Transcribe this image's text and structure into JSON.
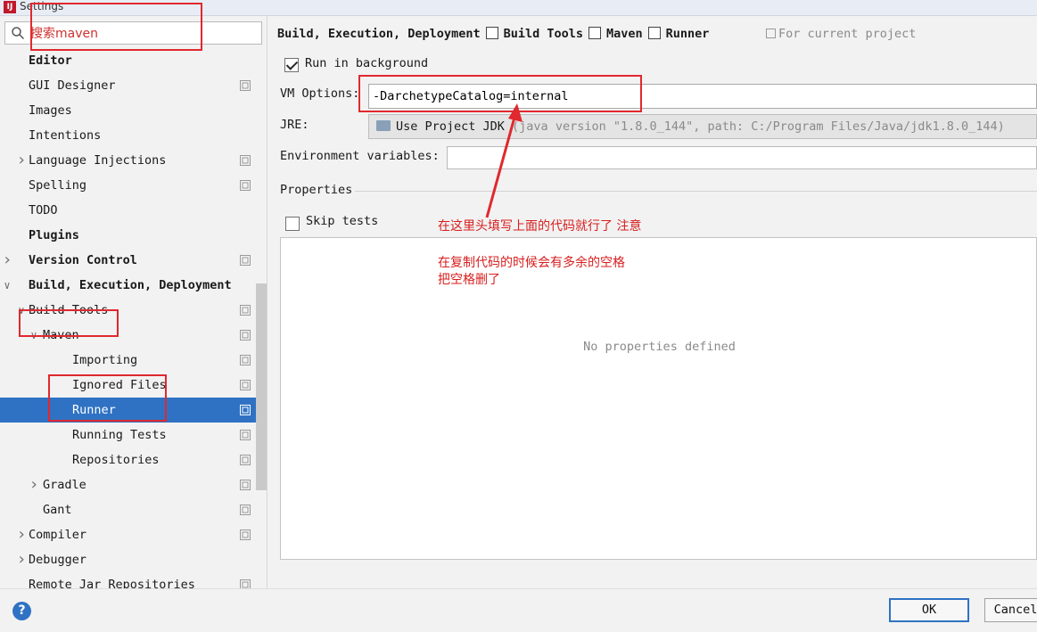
{
  "window": {
    "title": "Settings"
  },
  "search": {
    "value": "搜索maven"
  },
  "sidebar": {
    "items": [
      {
        "label": "Editor",
        "bold": true,
        "level": 0,
        "arrow": "",
        "selected": false,
        "project_icon": false
      },
      {
        "label": "GUI Designer",
        "bold": false,
        "level": 1,
        "arrow": "",
        "selected": false,
        "project_icon": true
      },
      {
        "label": "Images",
        "bold": false,
        "level": 1,
        "arrow": "",
        "selected": false,
        "project_icon": false
      },
      {
        "label": "Intentions",
        "bold": false,
        "level": 1,
        "arrow": "",
        "selected": false,
        "project_icon": false
      },
      {
        "label": "Language Injections",
        "bold": false,
        "level": 1,
        "arrow": "right",
        "selected": false,
        "project_icon": true
      },
      {
        "label": "Spelling",
        "bold": false,
        "level": 1,
        "arrow": "",
        "selected": false,
        "project_icon": true
      },
      {
        "label": "TODO",
        "bold": false,
        "level": 1,
        "arrow": "",
        "selected": false,
        "project_icon": false
      },
      {
        "label": "Plugins",
        "bold": true,
        "level": 0,
        "arrow": "",
        "selected": false,
        "project_icon": false
      },
      {
        "label": "Version Control",
        "bold": true,
        "level": 0,
        "arrow": "right",
        "selected": false,
        "project_icon": true
      },
      {
        "label": "Build, Execution, Deployment",
        "bold": true,
        "level": 0,
        "arrow": "down",
        "selected": false,
        "project_icon": false
      },
      {
        "label": "Build Tools",
        "bold": false,
        "level": 1,
        "arrow": "down",
        "selected": false,
        "project_icon": true
      },
      {
        "label": "Maven",
        "bold": false,
        "level": 2,
        "arrow": "down",
        "selected": false,
        "project_icon": true
      },
      {
        "label": "Importing",
        "bold": false,
        "level": 3,
        "arrow": "",
        "selected": false,
        "project_icon": true
      },
      {
        "label": "Ignored Files",
        "bold": false,
        "level": 3,
        "arrow": "",
        "selected": false,
        "project_icon": true
      },
      {
        "label": "Runner",
        "bold": false,
        "level": 3,
        "arrow": "",
        "selected": true,
        "project_icon": true
      },
      {
        "label": "Running Tests",
        "bold": false,
        "level": 3,
        "arrow": "",
        "selected": false,
        "project_icon": true
      },
      {
        "label": "Repositories",
        "bold": false,
        "level": 3,
        "arrow": "",
        "selected": false,
        "project_icon": true
      },
      {
        "label": "Gradle",
        "bold": false,
        "level": 2,
        "arrow": "right",
        "selected": false,
        "project_icon": true
      },
      {
        "label": "Gant",
        "bold": false,
        "level": 2,
        "arrow": "",
        "selected": false,
        "project_icon": true
      },
      {
        "label": "Compiler",
        "bold": false,
        "level": 1,
        "arrow": "right",
        "selected": false,
        "project_icon": true
      },
      {
        "label": "Debugger",
        "bold": false,
        "level": 1,
        "arrow": "right",
        "selected": false,
        "project_icon": false
      },
      {
        "label": "Remote Jar Repositories",
        "bold": false,
        "level": 1,
        "arrow": "",
        "selected": false,
        "project_icon": true
      }
    ]
  },
  "breadcrumb": {
    "parts": [
      "Build, Execution, Deployment",
      "Build Tools",
      "Maven",
      "Runner"
    ],
    "note": "For current project"
  },
  "form": {
    "run_in_background_label": "Run in background",
    "run_in_background_checked": true,
    "vm_options_label": "VM Options:",
    "vm_options_value": "-DarchetypeCatalog=internal",
    "jre_label": "JRE:",
    "jre_value": "Use Project JDK",
    "jre_detail": " (java version \"1.8.0_144\", path: C:/Program Files/Java/jdk1.8.0_144)",
    "env_label": "Environment variables:",
    "env_value": "",
    "properties_label": "Properties",
    "skip_tests_label": "Skip tests",
    "skip_tests_checked": false,
    "empty_properties": "No properties defined"
  },
  "annotations": {
    "line1": "在这里头填写上面的代码就行了 注意",
    "line2": "在复制代码的时候会有多余的空格",
    "line3": "把空格删了"
  },
  "footer": {
    "ok_label": "OK",
    "cancel_label": "Cancel",
    "help": "?"
  },
  "colors": {
    "selection": "#2f72c4",
    "annotation": "#d81e1e"
  }
}
